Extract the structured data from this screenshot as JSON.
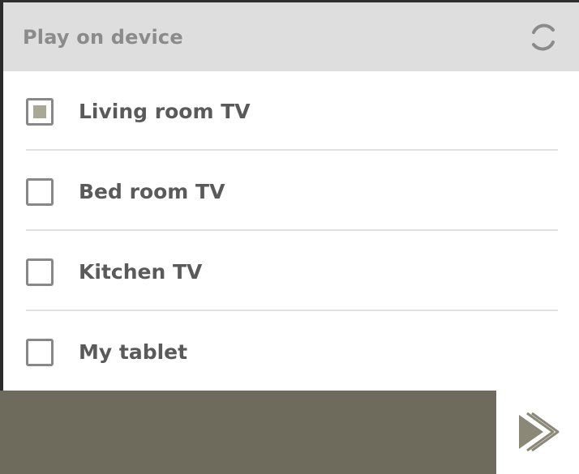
{
  "header": {
    "title": "Play on device",
    "refresh_icon": "refresh-icon"
  },
  "devices": [
    {
      "label": "Living room TV",
      "checked": true
    },
    {
      "label": "Bed room TV",
      "checked": false
    },
    {
      "label": "Kitchen TV",
      "checked": false
    },
    {
      "label": "My tablet",
      "checked": false
    }
  ],
  "footer": {
    "play_icon": "play-icon"
  },
  "colors": {
    "header_bg": "#dedede",
    "header_text": "#8b8b8b",
    "label_text": "#5a5a5a",
    "checkbox_border": "#888888",
    "checkbox_fill": "#a9a897",
    "footer_bar": "#6e6b5d",
    "divider": "#e1e1dd"
  }
}
